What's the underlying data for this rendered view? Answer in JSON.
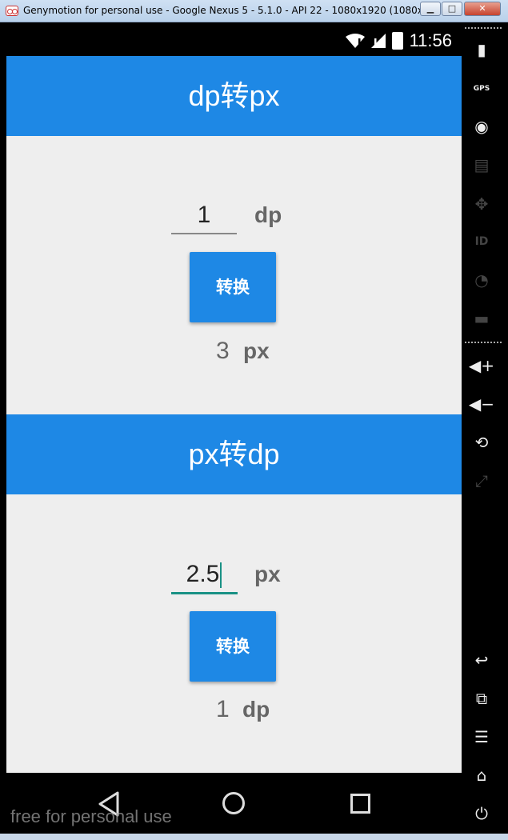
{
  "window": {
    "title": "Genymotion for personal use - Google Nexus 5 - 5.1.0 - API 22 - 1080x1920 (1080x1...",
    "min_glyph": "▁",
    "max_glyph": "□",
    "close_glyph": "✕"
  },
  "statusbar": {
    "time": "11:56"
  },
  "section1": {
    "title": "dp转px",
    "input_value": "1",
    "input_unit": "dp",
    "button_label": "转换",
    "result_value": "3",
    "result_unit": "px"
  },
  "section2": {
    "title": "px转dp",
    "input_value": "2.5",
    "input_unit": "px",
    "button_label": "转换",
    "result_value": "1",
    "result_unit": "dp"
  },
  "watermark": "free for personal use",
  "sidebar": {
    "items": [
      {
        "icon": "battery-icon",
        "glyph": "▮"
      },
      {
        "icon": "gps-icon",
        "glyph": "GPS"
      },
      {
        "icon": "camera-icon",
        "glyph": "◉"
      },
      {
        "icon": "media-icon",
        "glyph": "▤"
      },
      {
        "icon": "dpad-icon",
        "glyph": "✥"
      },
      {
        "icon": "id-icon",
        "glyph": "ID"
      },
      {
        "icon": "network-icon",
        "glyph": "◔"
      },
      {
        "icon": "sms-icon",
        "glyph": "▬"
      },
      {
        "icon": "volume-up-icon",
        "glyph": "◀+"
      },
      {
        "icon": "volume-down-icon",
        "glyph": "◀−"
      },
      {
        "icon": "rotate-icon",
        "glyph": "⟲"
      },
      {
        "icon": "scale-icon",
        "glyph": "⤢"
      },
      {
        "icon": "back-icon",
        "glyph": "↩"
      },
      {
        "icon": "recent-apps-icon",
        "glyph": "⧉"
      },
      {
        "icon": "menu-icon",
        "glyph": "☰"
      },
      {
        "icon": "home-icon",
        "glyph": "⌂"
      },
      {
        "icon": "power-icon",
        "glyph": "⏻"
      }
    ]
  }
}
